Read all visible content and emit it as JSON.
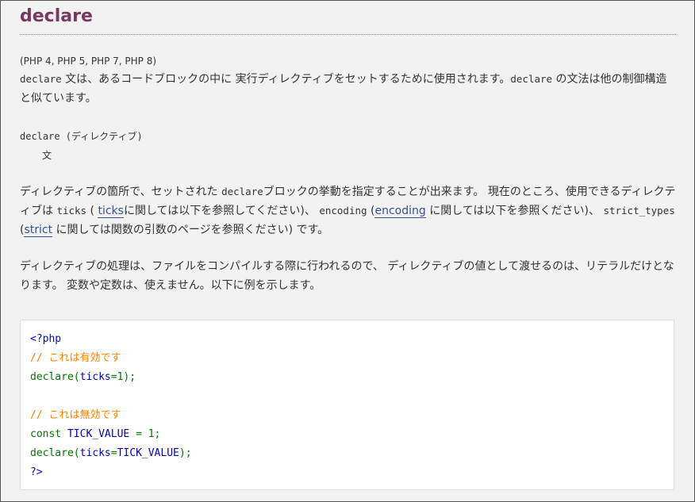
{
  "title": "declare",
  "versions": "(PHP 4, PHP 5, PHP 7, PHP 8)",
  "intro": {
    "code1": "declare",
    "t1": " 文は、あるコードブロックの中に 実行ディレクティブをセットするために使用されます。",
    "code2": "declare",
    "t2": " の文法は他の制御構造と似ています。"
  },
  "syntax": {
    "line1": "declare (ディレクティブ)",
    "line2": "文"
  },
  "description": {
    "t1": "ディレクティブの箇所で、セットされた ",
    "code1": "declare",
    "t2": "ブロックの挙動を指定することが出来ます。 現在のところ、使用できるディレクティブは ",
    "code2": "ticks",
    "t3": " ( ",
    "link1": "ticks",
    "t4": "に関しては以下を参照してください)、 ",
    "code3": "encoding",
    "t5": " (",
    "link2": "encoding",
    "t6": " に関しては以下を参照ください)、 ",
    "code4": "strict_types",
    "t7": " (",
    "link3": "strict",
    "t8": " に関しては関数の引数のページを参照ください) です。"
  },
  "notes": "ディレクティブの処理は、ファイルをコンパイルする際に行われるので、 ディレクティブの値として渡せるのは、リテラルだけとなります。 変数や定数は、使えません。以下に例を示します。",
  "example": {
    "open_tag": "<?php",
    "comment1": "// これは有効です",
    "line3_kw": "declare(",
    "line3_name": "ticks",
    "line3_rest": "=1);",
    "comment2": "// これは無効です",
    "line6_kw": "const ",
    "line6_name": "TICK_VALUE",
    "line6_rest": " = 1;",
    "line7_kw": "declare(",
    "line7_name": "ticks",
    "line7_mid": "=",
    "line7_name2": "TICK_VALUE",
    "line7_rest": ");",
    "close_tag": "?>"
  }
}
